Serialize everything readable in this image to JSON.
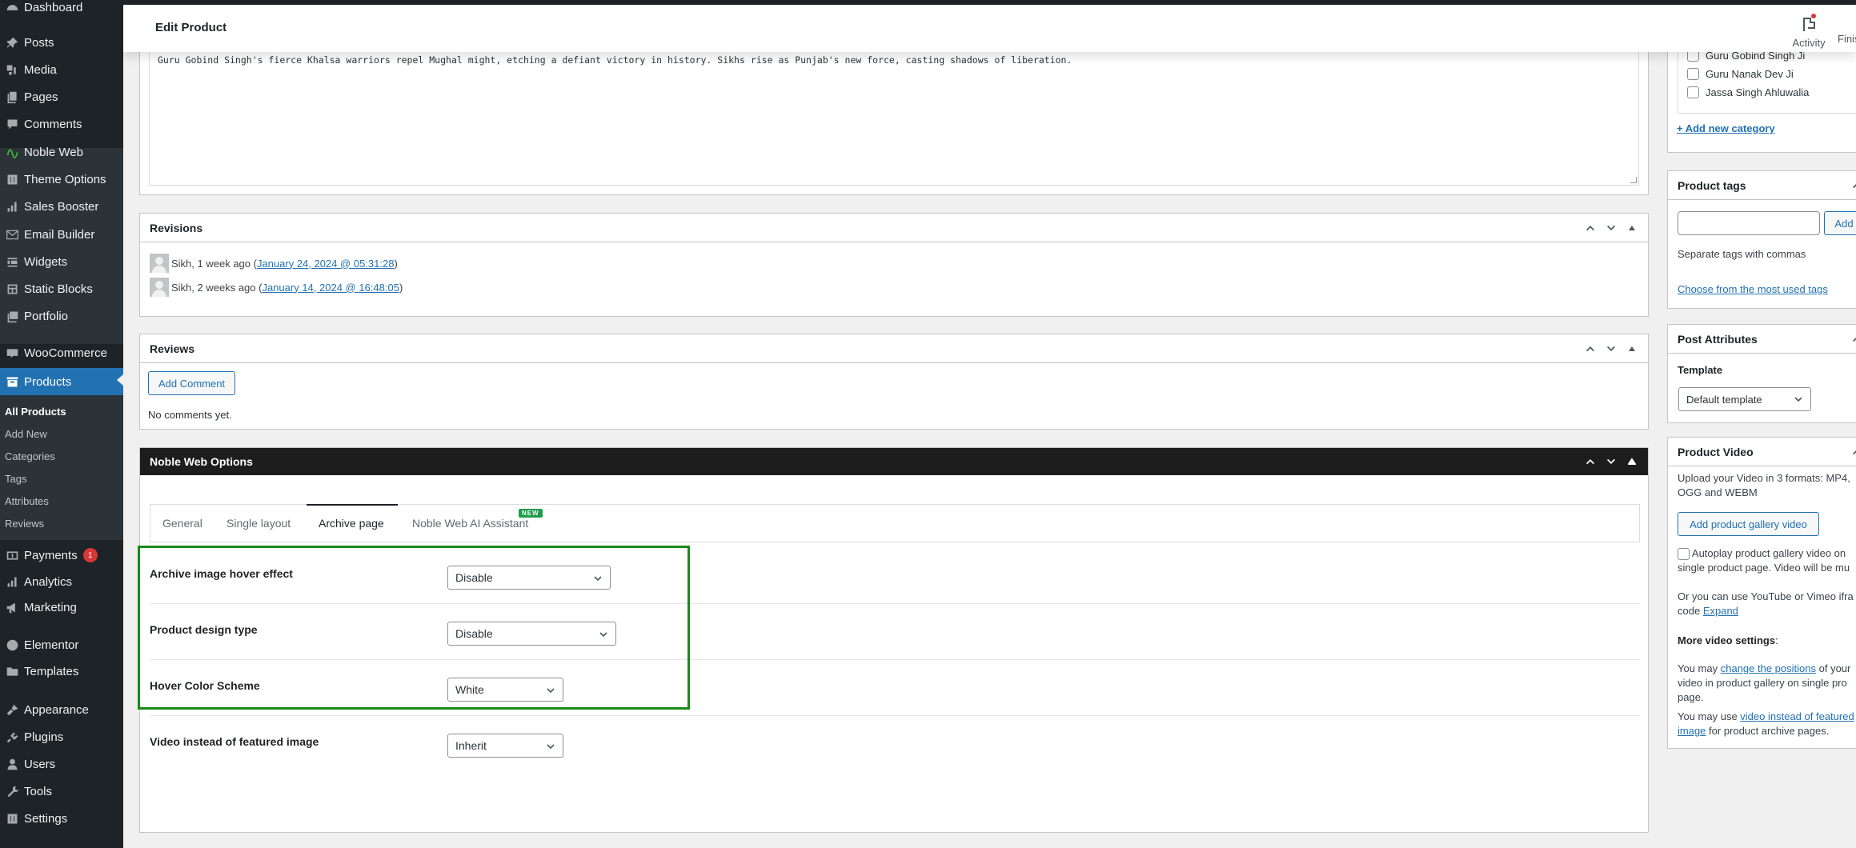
{
  "sidebar": {
    "items": [
      {
        "label": "Dashboard",
        "icon": "dashboard-icon"
      },
      {
        "label": "Posts",
        "icon": "pin-icon"
      },
      {
        "label": "Media",
        "icon": "media-icon"
      },
      {
        "label": "Pages",
        "icon": "pages-icon"
      },
      {
        "label": "Comments",
        "icon": "comment-icon"
      },
      {
        "label": "Noble Web",
        "icon": "noble-web-icon"
      },
      {
        "label": "Theme Options",
        "icon": "sliders-icon"
      },
      {
        "label": "Sales Booster",
        "icon": "bar-chart-icon"
      },
      {
        "label": "Email Builder",
        "icon": "envelope-icon"
      },
      {
        "label": "Widgets",
        "icon": "widgets-icon"
      },
      {
        "label": "Static Blocks",
        "icon": "blocks-icon"
      },
      {
        "label": "Portfolio",
        "icon": "portfolio-icon"
      },
      {
        "label": "WooCommerce",
        "icon": "woo-icon"
      },
      {
        "label": "Products",
        "icon": "archive-icon"
      },
      {
        "label": "Payments",
        "icon": "dollar-icon",
        "badge": "1"
      },
      {
        "label": "Analytics",
        "icon": "bar-chart-icon"
      },
      {
        "label": "Marketing",
        "icon": "megaphone-icon"
      },
      {
        "label": "Elementor",
        "icon": "elementor-icon"
      },
      {
        "label": "Templates",
        "icon": "folder-icon"
      },
      {
        "label": "Appearance",
        "icon": "brush-icon"
      },
      {
        "label": "Plugins",
        "icon": "plug-icon"
      },
      {
        "label": "Users",
        "icon": "user-icon"
      },
      {
        "label": "Tools",
        "icon": "wrench-icon"
      },
      {
        "label": "Settings",
        "icon": "sliders-icon"
      }
    ],
    "submenu": [
      "All Products",
      "Add New",
      "Categories",
      "Tags",
      "Attributes",
      "Reviews"
    ]
  },
  "header": {
    "title": "Edit Product",
    "activity_label": "Activity",
    "finish_label": "Finis"
  },
  "description": {
    "text": "Guru Gobind Singh's fierce Khalsa warriors repel Mughal might, etching a defiant victory in history. Sikhs rise as Punjab's new force, casting shadows of liberation."
  },
  "revisions": {
    "title": "Revisions",
    "items": [
      {
        "text": "Sikh, 1 week ago (",
        "link": "January 24, 2024 @ 05:31:28",
        "close": ")"
      },
      {
        "text": "Sikh, 2 weeks ago (",
        "link": "January 14, 2024 @ 16:48:05",
        "close": ")"
      }
    ]
  },
  "reviews": {
    "title": "Reviews",
    "add_button": "Add Comment",
    "empty_text": "No comments yet."
  },
  "noble_options": {
    "title": "Noble Web Options",
    "tabs": [
      {
        "label": "General"
      },
      {
        "label": "Single layout"
      },
      {
        "label": "Archive page",
        "active": true
      },
      {
        "label": "Noble Web AI Assistant",
        "badge": "NEW"
      }
    ],
    "rows": [
      {
        "label": "Archive image hover effect",
        "value": "Disable"
      },
      {
        "label": "Product design type",
        "value": "Disable"
      },
      {
        "label": "Hover Color Scheme",
        "value": "White"
      },
      {
        "label": "Video instead of featured image",
        "value": "Inherit"
      }
    ],
    "highlight_color": "#1a8a1a"
  },
  "categories": {
    "items": [
      "Guru Gobind Singh Ji",
      "Guru Nanak Dev Ji",
      "Jassa Singh Ahluwalia"
    ],
    "add_link": "+ Add new category"
  },
  "product_tags": {
    "title": "Product tags",
    "input_value": "",
    "add_button": "Add",
    "hint": "Separate tags with commas",
    "choose_link": "Choose from the most used tags"
  },
  "post_attributes": {
    "title": "Post Attributes",
    "template_label": "Template",
    "template_value": "Default template"
  },
  "product_video": {
    "title": "Product Video",
    "upload_text": "Upload your Video in 3 formats: MP4,",
    "upload_text2": "OGG and WEBM",
    "add_button": "Add product gallery video",
    "autoplay_text": "Autoplay product gallery video on",
    "autoplay_text2": "single product page. Video will be mu",
    "iframe_text": "Or you can use YouTube or Vimeo ifra",
    "iframe_text2": "code ",
    "expand_link": "Expand",
    "more_settings": "More video settings",
    "more_settings_colon": ":",
    "positions_prefix": "You may ",
    "positions_link": "change the positions",
    "positions_suffix": " of your",
    "positions_line2": "video in product gallery on single pro",
    "positions_line3": "page.",
    "featured_prefix": "You may use ",
    "featured_link": "video instead of featured",
    "featured_link2": "image",
    "featured_suffix": " for product archive pages."
  },
  "colors": {
    "accent": "#2271b1",
    "sidebar_bg": "#1d2327",
    "badge_red": "#d63638",
    "new_badge": "#1e9d4a"
  }
}
